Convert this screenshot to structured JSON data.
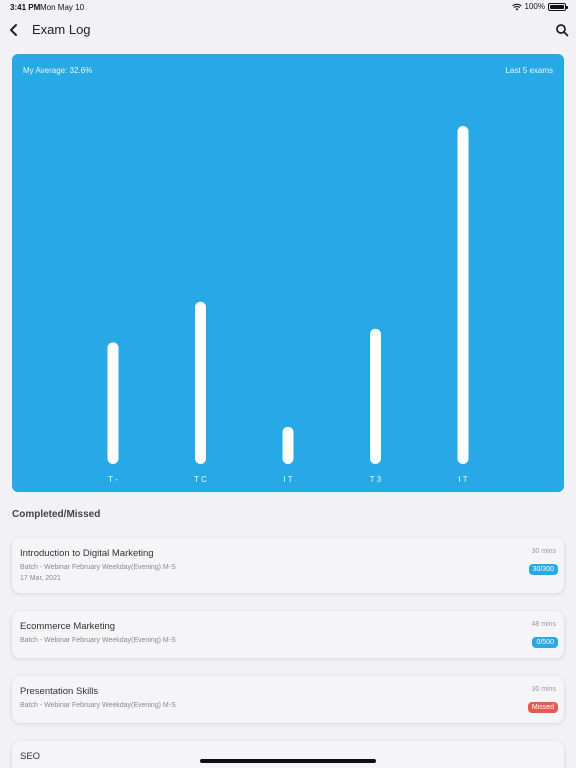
{
  "status_bar": {
    "time": "3:41 PM",
    "date": "Mon May 10",
    "battery": "100%"
  },
  "nav": {
    "title": "Exam Log",
    "back_icon": "chevron-left-icon",
    "search_icon": "search-icon"
  },
  "chart": {
    "average_label": "My Average: 32.6%",
    "range_label": "Last 5 exams",
    "background": "#27a9e6",
    "bar_color": "#ffffff"
  },
  "chart_data": {
    "type": "bar",
    "categories": [
      "T -",
      "T C",
      "I T",
      "T 3",
      "I T"
    ],
    "values": [
      36,
      48,
      11,
      40,
      100
    ],
    "ylim": [
      0,
      100
    ],
    "grid": false,
    "title": "",
    "xlabel": "",
    "ylabel": ""
  },
  "section": {
    "title": "Completed/Missed"
  },
  "exams": [
    {
      "name": "Introduction to Digital Marketing",
      "batch": "Batch - Webinar February Weekday(Evening) M-S",
      "date": "17 Mar, 2021",
      "duration": "30 mins",
      "status": "30/300",
      "status_color": "#27a9e6"
    },
    {
      "name": "Ecommerce Marketing",
      "batch": "Batch - Webinar February Weekday(Evening) M-S",
      "date": "",
      "duration": "48 mins",
      "status": "0/500",
      "status_color": "#27a9e6"
    },
    {
      "name": "Presentation Skills",
      "batch": "Batch - Webinar February Weekday(Evening) M-S",
      "date": "",
      "duration": "30 mins",
      "status": "Missed",
      "status_color": "#e85a4f"
    },
    {
      "name": "SEO",
      "batch": "",
      "date": "",
      "duration": "",
      "status": "",
      "status_color": "#27a9e6"
    }
  ]
}
